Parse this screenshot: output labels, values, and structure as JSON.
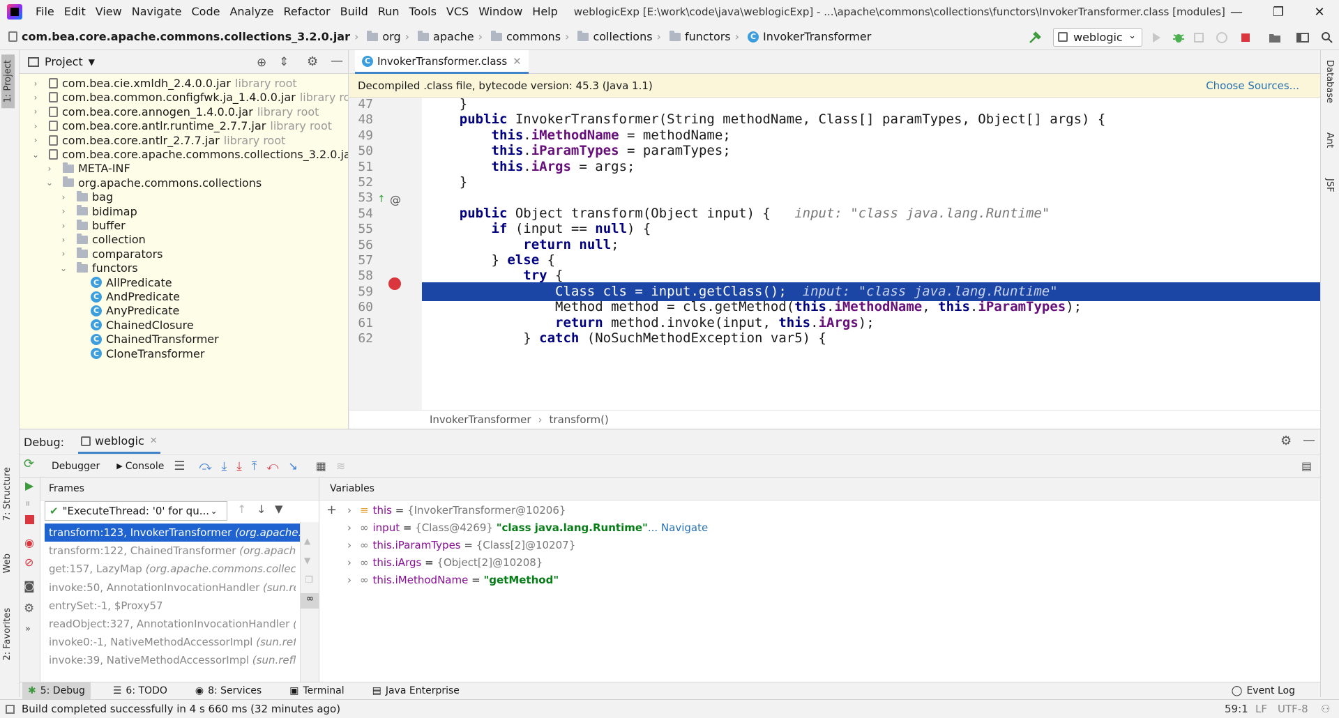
{
  "app": {
    "menus": [
      "File",
      "Edit",
      "View",
      "Navigate",
      "Code",
      "Analyze",
      "Refactor",
      "Build",
      "Run",
      "Tools",
      "VCS",
      "Window",
      "Help"
    ],
    "window_title": "weblogicExp [E:\\work\\code\\java\\weblogicExp] - ...\\apache\\commons\\collections\\functors\\InvokerTransformer.class [modules]"
  },
  "breadcrumbs": [
    "com.bea.core.apache.commons.collections_3.2.0.jar",
    "org",
    "apache",
    "commons",
    "collections",
    "functors",
    "InvokerTransformer"
  ],
  "run_config": "weblogic",
  "left_tool_tabs": {
    "project": "1: Project",
    "structure": "7: Structure",
    "web": "Web",
    "favorites": "2: Favorites"
  },
  "right_tool_tabs": {
    "database": "Database",
    "ant": "Ant",
    "jsf": "JSF"
  },
  "project": {
    "title": "Project",
    "tree": [
      {
        "label": "com.bea.cie.xmldh_2.4.0.0.jar",
        "suffix": "library root",
        "arrow": "›"
      },
      {
        "label": "com.bea.common.configfwk.ja_1.4.0.0.jar",
        "suffix": "library root",
        "arrow": "›"
      },
      {
        "label": "com.bea.core.annogen_1.4.0.0.jar",
        "suffix": "library root",
        "arrow": "›"
      },
      {
        "label": "com.bea.core.antlr.runtime_2.7.7.jar",
        "suffix": "library root",
        "arrow": "›"
      },
      {
        "label": "com.bea.core.antlr_2.7.7.jar",
        "suffix": "library root",
        "arrow": "›"
      },
      {
        "label": "com.bea.core.apache.commons.collections_3.2.0.jar",
        "suffix": "lil",
        "arrow": "⌄"
      },
      {
        "label": "META-INF",
        "suffix": "",
        "arrow": "›"
      },
      {
        "label": "org.apache.commons.collections",
        "suffix": "",
        "arrow": "⌄"
      },
      {
        "label": "bag",
        "suffix": "",
        "arrow": "›"
      },
      {
        "label": "bidimap",
        "suffix": "",
        "arrow": "›"
      },
      {
        "label": "buffer",
        "suffix": "",
        "arrow": "›"
      },
      {
        "label": "collection",
        "suffix": "",
        "arrow": "›"
      },
      {
        "label": "comparators",
        "suffix": "",
        "arrow": "›"
      },
      {
        "label": "functors",
        "suffix": "",
        "arrow": "⌄"
      },
      {
        "label": "AllPredicate",
        "suffix": "",
        "arrow": ""
      },
      {
        "label": "AndPredicate",
        "suffix": "",
        "arrow": ""
      },
      {
        "label": "AnyPredicate",
        "suffix": "",
        "arrow": ""
      },
      {
        "label": "ChainedClosure",
        "suffix": "",
        "arrow": ""
      },
      {
        "label": "ChainedTransformer",
        "suffix": "",
        "arrow": ""
      },
      {
        "label": "CloneTransformer",
        "suffix": "",
        "arrow": ""
      }
    ]
  },
  "editor": {
    "tab": "InvokerTransformer.class",
    "decompiled_notice": "Decompiled .class file, bytecode version: 45.3 (Java 1.1)",
    "choose_sources": "Choose Sources...",
    "lines": [
      {
        "n": "47",
        "code": "    }"
      },
      {
        "n": "48",
        "code": "    public InvokerTransformer(String methodName, Class[] paramTypes, Object[] args) {"
      },
      {
        "n": "49",
        "code": "        this.iMethodName = methodName;"
      },
      {
        "n": "50",
        "code": "        this.iParamTypes = paramTypes;"
      },
      {
        "n": "51",
        "code": "        this.iArgs = args;"
      },
      {
        "n": "52",
        "code": "    }"
      },
      {
        "n": "53",
        "code": ""
      },
      {
        "n": "54",
        "code": "    public Object transform(Object input) {   ",
        "hint": "input: \"class java.lang.Runtime\""
      },
      {
        "n": "55",
        "code": "        if (input == null) {"
      },
      {
        "n": "56",
        "code": "            return null;"
      },
      {
        "n": "57",
        "code": "        } else {"
      },
      {
        "n": "58",
        "code": "            try {"
      },
      {
        "n": "59",
        "code": "                Class cls = input.getClass();  ",
        "hint": "input: \"class java.lang.Runtime\""
      },
      {
        "n": "60",
        "code": "                Method method = cls.getMethod(this.iMethodName, this.iParamTypes);"
      },
      {
        "n": "61",
        "code": "                return method.invoke(input, this.iArgs);"
      },
      {
        "n": "62",
        "code": "            } catch (NoSuchMethodException var5) {"
      }
    ],
    "selected_line": "59",
    "crumb": [
      "InvokerTransformer",
      "transform()"
    ]
  },
  "debug": {
    "label": "Debug:",
    "session": "weblogic",
    "tabs": [
      "Debugger",
      "Console"
    ],
    "frames_header": "Frames",
    "variables_header": "Variables",
    "thread": "\"ExecuteThread: '0' for qu...",
    "frames": [
      {
        "method": "transform:123, InvokerTransformer ",
        "pkg": "(org.apache.commons.collections.functors"
      },
      {
        "method": "transform:122, ChainedTransformer ",
        "pkg": "(org.apache.c"
      },
      {
        "method": "get:157, LazyMap ",
        "pkg": "(org.apache.commons.collecti"
      },
      {
        "method": "invoke:50, AnnotationInvocationHandler ",
        "pkg": "(sun.refl"
      },
      {
        "method": "entrySet:-1, $Proxy57",
        "pkg": ""
      },
      {
        "method": "readObject:327, AnnotationInvocationHandler ",
        "pkg": "(s"
      },
      {
        "method": "invoke0:-1, NativeMethodAccessorImpl ",
        "pkg": "(sun.refle"
      },
      {
        "method": "invoke:39, NativeMethodAccessorImpl ",
        "pkg": "(sun.refle"
      }
    ],
    "variables": [
      {
        "name": "this",
        "eq": " = ",
        "val": "{InvokerTransformer@10206}",
        "str": "",
        "nav": ""
      },
      {
        "name": "input",
        "eq": " = ",
        "val": "{Class@4269} ",
        "str": "\"class java.lang.Runtime\"",
        "nav": "... Navigate"
      },
      {
        "name": "this.iParamTypes",
        "eq": " = ",
        "val": "{Class[2]@10207}",
        "str": "",
        "nav": ""
      },
      {
        "name": "this.iArgs",
        "eq": " = ",
        "val": "{Object[2]@10208}",
        "str": "",
        "nav": ""
      },
      {
        "name": "this.iMethodName",
        "eq": " = ",
        "val": "",
        "str": "\"getMethod\"",
        "nav": ""
      }
    ]
  },
  "bottom_tabs": [
    "5: Debug",
    "6: TODO",
    "8: Services",
    "Terminal",
    "Java Enterprise"
  ],
  "event_log": "Event Log",
  "status": {
    "message": "Build completed successfully in 4 s 660 ms (32 minutes ago)",
    "position": "59:1",
    "line_sep": "LF",
    "encoding": "UTF-8"
  },
  "colors": {
    "selection": "#1b46a6",
    "keyword": "#000080",
    "field": "#660e7a",
    "string": "#067d17",
    "link": "#2470b3"
  }
}
